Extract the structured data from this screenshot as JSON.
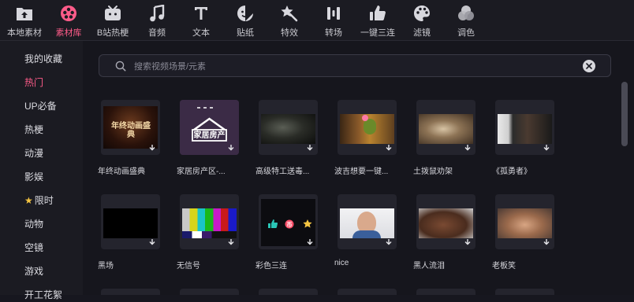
{
  "toolbar": {
    "items": [
      {
        "label": "本地素材",
        "icon": "upload-folder-icon"
      },
      {
        "label": "素材库",
        "icon": "film-reel-icon"
      },
      {
        "label": "B站热梗",
        "icon": "bilibili-tv-icon"
      },
      {
        "label": "音频",
        "icon": "music-note-icon"
      },
      {
        "label": "文本",
        "icon": "text-t-icon"
      },
      {
        "label": "贴纸",
        "icon": "sticker-icon"
      },
      {
        "label": "特效",
        "icon": "magic-star-icon"
      },
      {
        "label": "转场",
        "icon": "transition-icon"
      },
      {
        "label": "一键三连",
        "icon": "thumbs-up-icon"
      },
      {
        "label": "滤镜",
        "icon": "palette-icon"
      },
      {
        "label": "调色",
        "icon": "color-circles-icon"
      }
    ],
    "active_index": 1
  },
  "sidebar": {
    "items": [
      {
        "label": "我的收藏"
      },
      {
        "label": "热门"
      },
      {
        "label": "UP必备"
      },
      {
        "label": "热梗"
      },
      {
        "label": "动漫"
      },
      {
        "label": "影娱"
      },
      {
        "label": "限时"
      },
      {
        "label": "动物"
      },
      {
        "label": "空镜"
      },
      {
        "label": "游戏"
      },
      {
        "label": "开工花絮"
      }
    ],
    "active_index": 1
  },
  "search": {
    "placeholder": "搜索视频场景/元素",
    "value": ""
  },
  "cards": [
    {
      "title": "年终动画盛典",
      "thumb_text": "年终动画盛典"
    },
    {
      "title": "家居房产区-...",
      "thumb_text": "家居房产"
    },
    {
      "title": "高级特工送毒..."
    },
    {
      "title": "波吉想要一键..."
    },
    {
      "title": "土拨鼠劝架"
    },
    {
      "title": "《孤勇者》"
    },
    {
      "title": "黑场"
    },
    {
      "title": "无信号"
    },
    {
      "title": "彩色三连"
    },
    {
      "title": "nice"
    },
    {
      "title": "黑人流泪"
    },
    {
      "title": "老板笑"
    }
  ],
  "colors": {
    "accent": "#ff5c8a",
    "background": "#16161d",
    "panel": "#1b1b22"
  }
}
